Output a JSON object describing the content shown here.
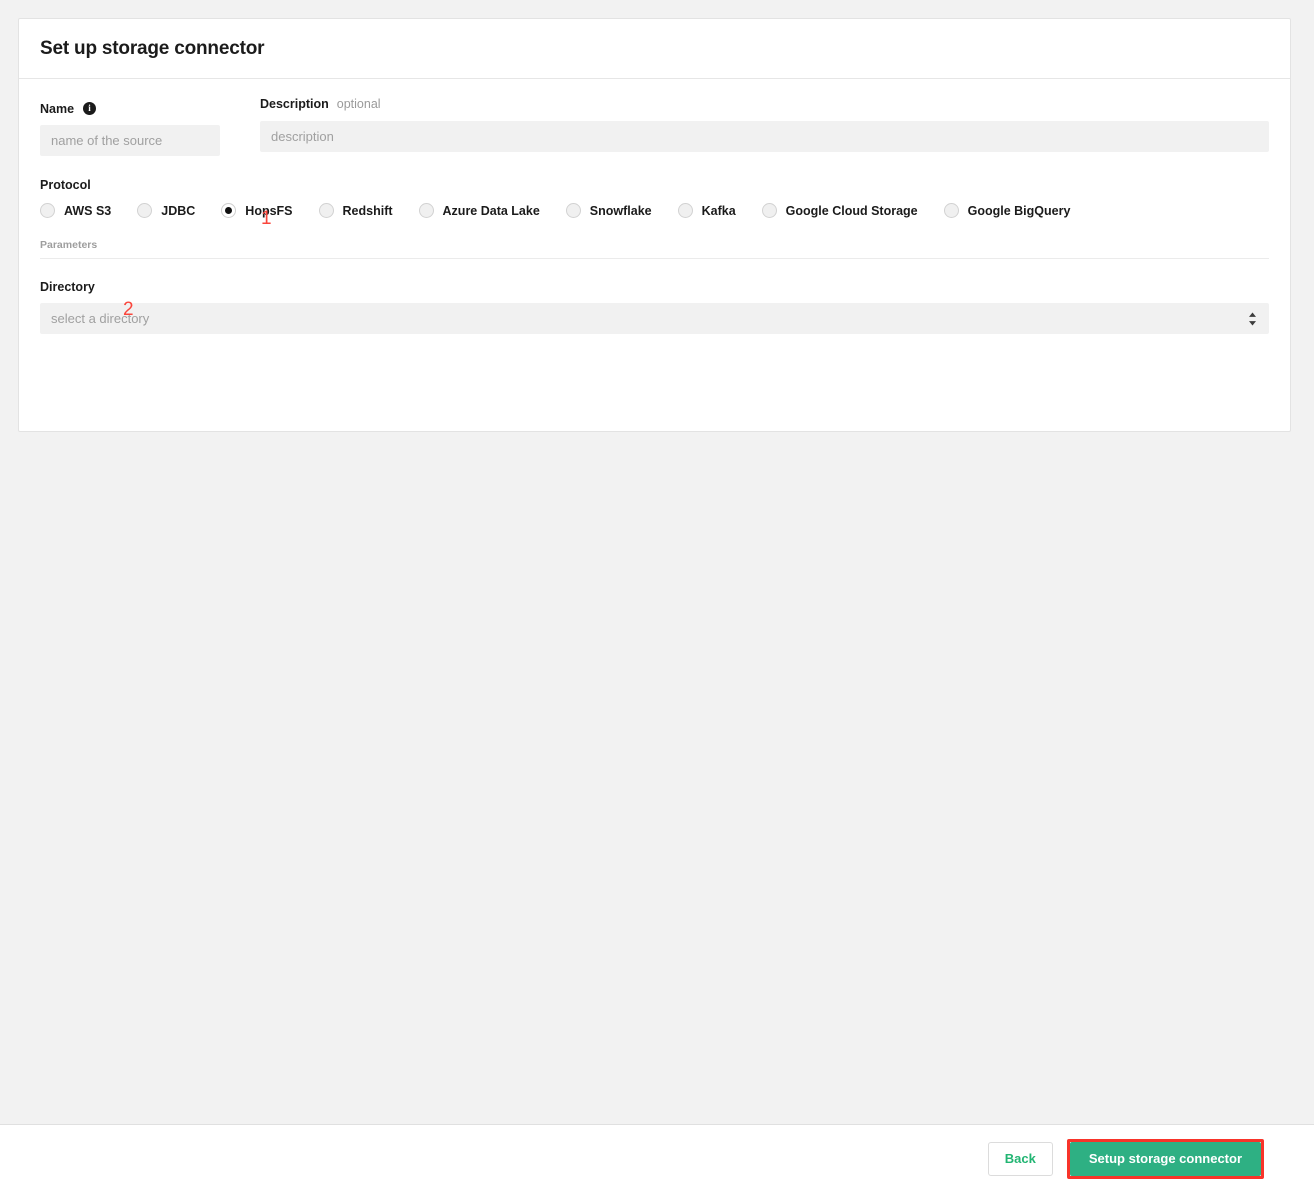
{
  "card": {
    "title": "Set up storage connector"
  },
  "name_field": {
    "label": "Name",
    "info_icon": "info-icon",
    "info_glyph": "i",
    "value": "",
    "placeholder": "name of the source"
  },
  "description_field": {
    "label": "Description",
    "optional_tag": "optional",
    "value": "",
    "placeholder": "description"
  },
  "protocol": {
    "label": "Protocol",
    "selected": "HopsFS",
    "options": [
      {
        "label": "AWS S3",
        "checked": false
      },
      {
        "label": "JDBC",
        "checked": false
      },
      {
        "label": "HopsFS",
        "checked": true
      },
      {
        "label": "Redshift",
        "checked": false
      },
      {
        "label": "Azure Data Lake",
        "checked": false
      },
      {
        "label": "Snowflake",
        "checked": false
      },
      {
        "label": "Kafka",
        "checked": false
      },
      {
        "label": "Google Cloud Storage",
        "checked": false
      },
      {
        "label": "Google BigQuery",
        "checked": false
      }
    ]
  },
  "parameters": {
    "section_label": "Parameters",
    "directory": {
      "label": "Directory",
      "value": "",
      "placeholder": "select a directory",
      "options": [
        "select a directory"
      ]
    }
  },
  "annotations": [
    {
      "text": "1",
      "target": "HopsFS"
    },
    {
      "text": "2",
      "target": "Directory"
    }
  ],
  "footer": {
    "back_label": "Back",
    "submit_label": "Setup storage connector"
  },
  "colors": {
    "page_background": "#f2f2f2",
    "card_background": "#ffffff",
    "primary_green": "#2eb083",
    "back_text_green": "#22b573",
    "annotation_red": "#fa463c",
    "highlight_red": "#f8342a",
    "input_background": "#f1f1f1",
    "text_dark": "#1b1b1b",
    "placeholder_gray": "#a0a0a0"
  }
}
